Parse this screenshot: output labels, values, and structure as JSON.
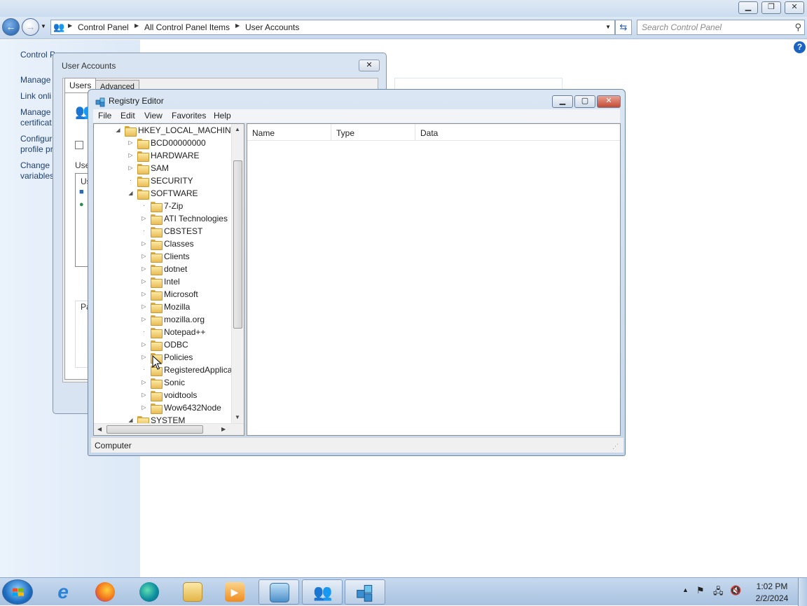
{
  "explorer": {
    "breadcrumb": [
      "Control Panel",
      "All Control Panel Items",
      "User Accounts"
    ],
    "search_placeholder": "Search Control Panel",
    "left_links": {
      "home": "Control P",
      "manage": "Manage",
      "link_online": "Link onli",
      "manage_cert_1": "Manage",
      "manage_cert_2": "certificat",
      "configure_1": "Configur",
      "configure_2": "profile pr",
      "change_env_1": "Change",
      "change_env_2": "variables"
    }
  },
  "user_accounts_dialog": {
    "title": "User Accounts",
    "tabs": [
      "Users",
      "Advanced"
    ],
    "checkbox_label": "U",
    "users_label": "Use",
    "list_header": "Us",
    "password_label": "Pa"
  },
  "registry_editor": {
    "title": "Registry Editor",
    "menu": [
      "File",
      "Edit",
      "View",
      "Favorites",
      "Help"
    ],
    "tree": {
      "root": "HKEY_LOCAL_MACHINE",
      "level1": [
        {
          "label": "BCD00000000",
          "expander": "collapsed"
        },
        {
          "label": "HARDWARE",
          "expander": "collapsed"
        },
        {
          "label": "SAM",
          "expander": "collapsed"
        },
        {
          "label": "SECURITY",
          "expander": "none"
        },
        {
          "label": "SOFTWARE",
          "expander": "expanded"
        }
      ],
      "software_children": [
        {
          "label": "7-Zip",
          "expander": "none"
        },
        {
          "label": "ATI Technologies",
          "expander": "collapsed"
        },
        {
          "label": "CBSTEST",
          "expander": "none"
        },
        {
          "label": "Classes",
          "expander": "collapsed"
        },
        {
          "label": "Clients",
          "expander": "collapsed"
        },
        {
          "label": "dotnet",
          "expander": "collapsed"
        },
        {
          "label": "Intel",
          "expander": "collapsed"
        },
        {
          "label": "Microsoft",
          "expander": "collapsed"
        },
        {
          "label": "Mozilla",
          "expander": "collapsed"
        },
        {
          "label": "mozilla.org",
          "expander": "collapsed"
        },
        {
          "label": "Notepad++",
          "expander": "none"
        },
        {
          "label": "ODBC",
          "expander": "collapsed"
        },
        {
          "label": "Policies",
          "expander": "collapsed"
        },
        {
          "label": "RegisteredApplica",
          "expander": "none"
        },
        {
          "label": "Sonic",
          "expander": "collapsed"
        },
        {
          "label": "voidtools",
          "expander": "collapsed"
        },
        {
          "label": "Wow6432Node",
          "expander": "collapsed"
        }
      ],
      "after": "SYSTEM"
    },
    "columns": [
      "Name",
      "Type",
      "Data"
    ],
    "status": "Computer"
  },
  "taskbar": {
    "items": [
      "Start",
      "Internet Explorer",
      "Firefox",
      "Edge",
      "File Explorer",
      "Media Player",
      "Control Panel",
      "User Accounts",
      "Registry Editor"
    ],
    "time": "1:02 PM",
    "date": "2/2/2024"
  },
  "colors": {
    "accent": "#1f6fc2",
    "link": "#1f3f6e",
    "folder": "#e8bd54",
    "close_red": "#c44a32"
  }
}
